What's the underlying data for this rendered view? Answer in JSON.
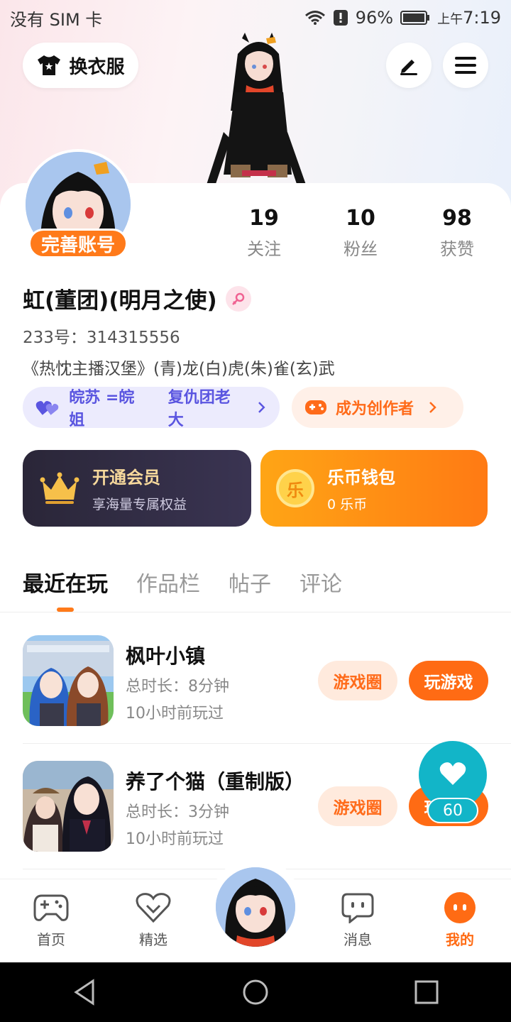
{
  "status_bar": {
    "carrier": "没有 SIM 卡",
    "battery": "96%",
    "time": "上午7:19",
    "time_prefix": "上午",
    "time_value": "7:19"
  },
  "header": {
    "wardrobe_label": "换衣服",
    "edit_icon": "pen-icon",
    "menu_icon": "menu-icon"
  },
  "profile": {
    "complete_badge": "完善账号",
    "stats": [
      {
        "value": "19",
        "label": "关注"
      },
      {
        "value": "10",
        "label": "粉丝"
      },
      {
        "value": "98",
        "label": "获赞"
      }
    ],
    "nickname": "虹(董团)(明月之使)",
    "uid": "233号：314315556",
    "bio": "《热忱主播汉堡》(青)龙(白)虎(朱)雀(玄)武",
    "group_pill": {
      "part1": "皖苏 =皖姐",
      "part2": "复仇团老大"
    },
    "creator_pill": "成为创作者"
  },
  "cards": {
    "vip": {
      "title": "开通会员",
      "subtitle": "享海量专属权益"
    },
    "wallet": {
      "title": "乐币钱包",
      "subtitle": "0 乐币",
      "coin_glyph": "乐"
    }
  },
  "tabs": [
    "最近在玩",
    "作品栏",
    "帖子",
    "评论"
  ],
  "games": [
    {
      "title": "枫叶小镇",
      "duration": "总时长：8分钟",
      "last_played": "10小时前玩过",
      "circle_btn": "游戏圈",
      "play_btn": "玩游戏"
    },
    {
      "title": "养了个猫（重制版）",
      "duration": "总时长：3分钟",
      "last_played": "10小时前玩过",
      "circle_btn": "游戏圈",
      "play_btn": "玩游戏"
    }
  ],
  "like_fab": {
    "count": "60"
  },
  "bottom_nav": [
    {
      "label": "首页",
      "icon": "gamepad-icon"
    },
    {
      "label": "精选",
      "icon": "heart-badge-icon"
    },
    {
      "label": "消息",
      "icon": "chat-icon"
    },
    {
      "label": "我的",
      "icon": "profile-face-icon"
    }
  ],
  "colors": {
    "accent": "#ff6b14",
    "purple": "#5a55e0",
    "teal": "#12b5c8"
  }
}
